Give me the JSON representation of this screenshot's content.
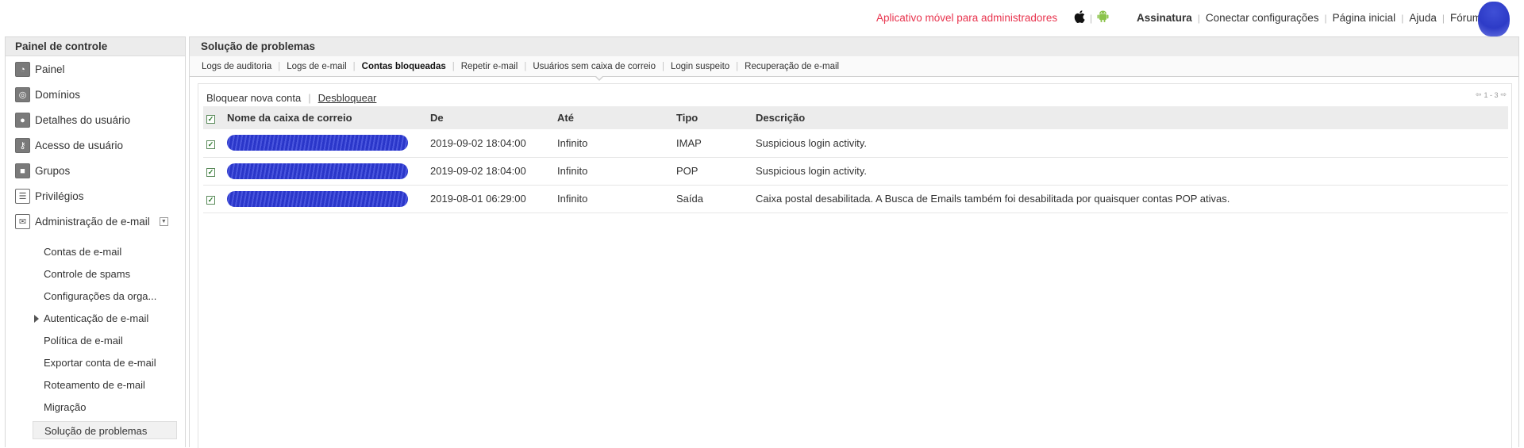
{
  "topbar": {
    "promo": "Aplicativo móvel para administradores",
    "platforms": [
      "apple-icon",
      "android-icon"
    ],
    "links": [
      "Assinatura",
      "Conectar configurações",
      "Página inicial",
      "Ajuda",
      "Fórum"
    ]
  },
  "sidebar": {
    "title": "Painel de controle",
    "items": [
      {
        "label": "Painel",
        "icon": "dashboard-icon"
      },
      {
        "label": "Domínios",
        "icon": "globe-icon"
      },
      {
        "label": "Detalhes do usuário",
        "icon": "user-icon"
      },
      {
        "label": "Acesso de usuário",
        "icon": "user-access-icon"
      },
      {
        "label": "Grupos",
        "icon": "groups-icon"
      },
      {
        "label": "Privilégios",
        "icon": "privileges-icon"
      },
      {
        "label": "Administração de e-mail",
        "icon": "mail-icon"
      }
    ],
    "subitems": [
      "Contas de e-mail",
      "Controle de spams",
      "Configurações da orga...",
      "Autenticação de e-mail",
      "Política de e-mail",
      "Exportar conta de e-mail",
      "Roteamento de e-mail",
      "Migração",
      "Solução de problemas"
    ]
  },
  "main": {
    "title": "Solução de problemas",
    "tabs": [
      "Logs de auditoria",
      "Logs de e-mail",
      "Contas bloqueadas",
      "Repetir e-mail",
      "Usuários sem caixa de correio",
      "Login suspeito",
      "Recuperação de e-mail"
    ],
    "active_tab": "Contas bloqueadas",
    "actions": {
      "block": "Bloquear nova conta",
      "unblock": "Desbloquear"
    },
    "pager": "1 - 3",
    "table": {
      "columns": [
        "Nome da caixa de correio",
        "De",
        "Até",
        "Tipo",
        "Descrição"
      ],
      "rows": [
        {
          "mailbox": "",
          "from": "2019-09-02 18:04:00",
          "until": "Infinito",
          "type": "IMAP",
          "description": "Suspicious login activity."
        },
        {
          "mailbox": "",
          "from": "2019-09-02 18:04:00",
          "until": "Infinito",
          "type": "POP",
          "description": "Suspicious login activity."
        },
        {
          "mailbox": "",
          "from": "2019-08-01 06:29:00",
          "until": "Infinito",
          "type": "Saída",
          "description": "Caixa postal desabilitada. A Busca de Emails também foi desabilitada por quaisquer contas POP ativas."
        }
      ]
    }
  },
  "colors": {
    "promo": "#e8344e",
    "header_bg": "#ececec",
    "redaction": "#2a36c9"
  }
}
